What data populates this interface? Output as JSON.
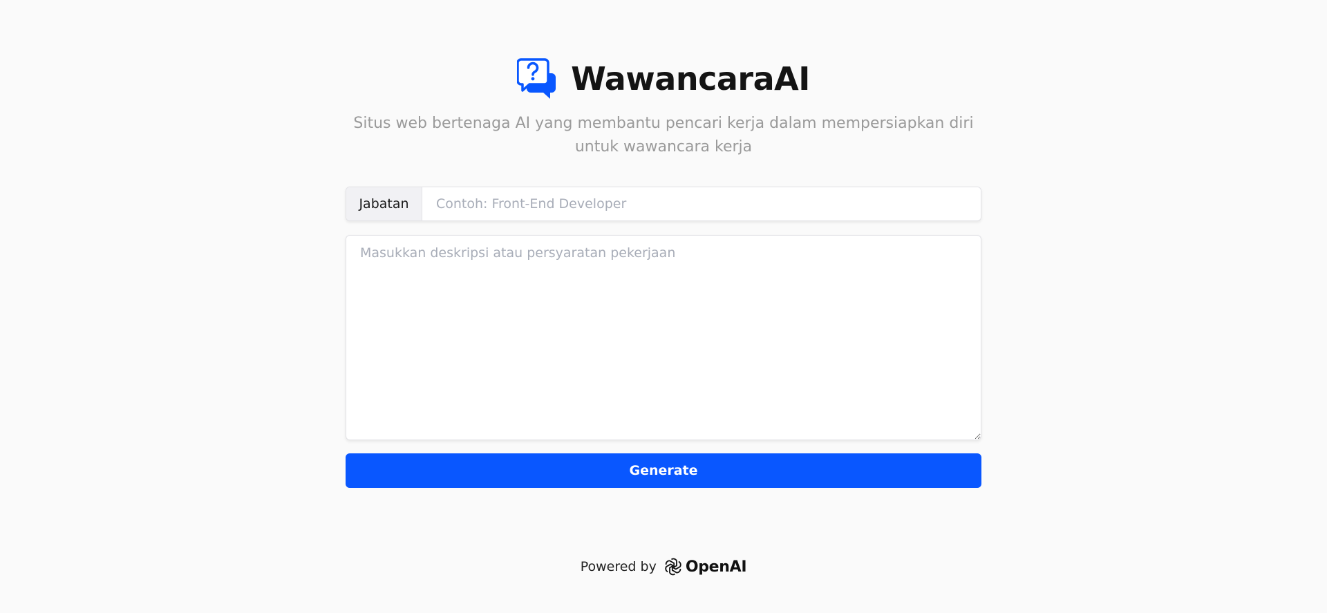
{
  "header": {
    "logo_icon": "chat-question-icon",
    "title": "WawancaraAI",
    "subtitle": "Situs web bertenaga AI yang membantu pencari kerja dalam mempersiapkan diri untuk wawancara kerja"
  },
  "form": {
    "job_label": "Jabatan",
    "job_value": "",
    "job_placeholder": "Contoh: Front-End Developer",
    "description_value": "",
    "description_placeholder": "Masukkan deskripsi atau persyaratan pekerjaan",
    "generate_label": "Generate"
  },
  "footer": {
    "powered_label": "Powered by",
    "brand_icon": "openai-icon",
    "brand_name": "OpenAI"
  },
  "colors": {
    "accent": "#0957ff",
    "background": "#fafafa",
    "subtitle_text": "#9a9a9a"
  }
}
